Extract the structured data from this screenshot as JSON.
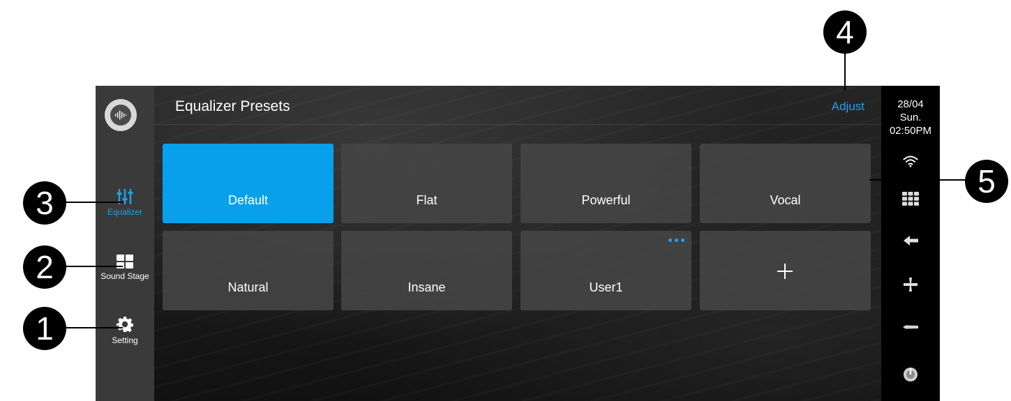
{
  "sidebar": {
    "logo_icon": "sound-wave-icon",
    "items": [
      {
        "label": "Equalizer",
        "icon": "equalizer-sliders-icon",
        "active": true
      },
      {
        "label": "Sound Stage",
        "icon": "grid-blocks-icon",
        "active": false
      },
      {
        "label": "Setting",
        "icon": "gear-icon",
        "active": false
      }
    ]
  },
  "header": {
    "title": "Equalizer Presets",
    "adjust_label": "Adjust"
  },
  "presets": [
    {
      "label": "Default",
      "selected": true
    },
    {
      "label": "Flat",
      "selected": false
    },
    {
      "label": "Powerful",
      "selected": false
    },
    {
      "label": "Vocal",
      "selected": false
    },
    {
      "label": "Natural",
      "selected": false
    },
    {
      "label": "Insane",
      "selected": false
    },
    {
      "label": "User1",
      "selected": false,
      "has_menu": true
    },
    {
      "label": "",
      "add_button": true,
      "icon": "plus-icon"
    }
  ],
  "status": {
    "date": "28/04",
    "day": "Sun.",
    "time": "02:50PM"
  },
  "right_rail_icons": [
    "wifi-icon",
    "apps-grid-icon",
    "back-arrow-icon",
    "volume-up-icon",
    "volume-down-icon",
    "power-icon"
  ],
  "callouts": [
    "1",
    "2",
    "3",
    "4",
    "5"
  ],
  "colors": {
    "accent": "#1ea3ea",
    "selected_tile": "#08a0ea",
    "tile": "#464646",
    "sidebar": "#3a3a3a"
  }
}
